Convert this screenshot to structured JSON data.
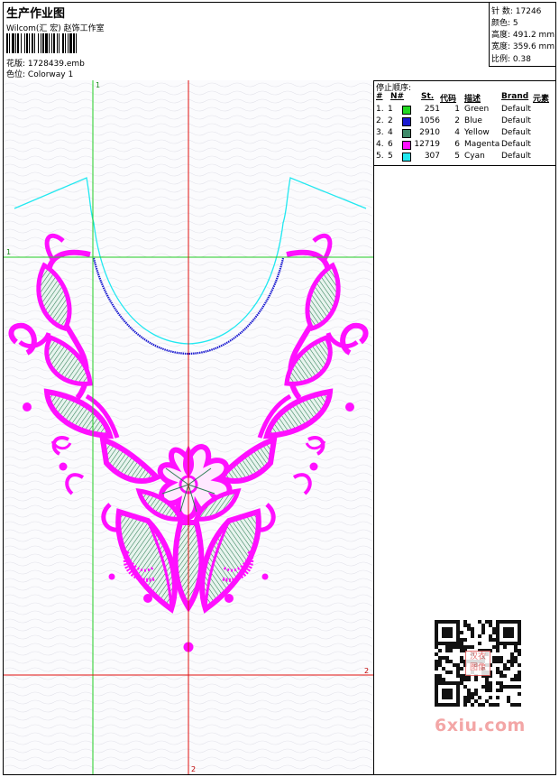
{
  "header": {
    "title": "生产作业图",
    "company": "Wilcom(汇 宏) 赵饰工作室",
    "design_label": "花版:",
    "design_value": "1728439.emb",
    "colorway_label": "色位:",
    "colorway_value": "Colorway 1"
  },
  "stats": {
    "stitches_label": "针 数:",
    "stitches_value": "17246",
    "colors_label": "颜色:",
    "colors_value": "5",
    "height_label": "高度:",
    "height_value": "491.2 mm",
    "width_label": "宽度:",
    "width_value": "359.6 mm",
    "scale_label": "比例:",
    "scale_value": "0.38"
  },
  "stop_sequence": {
    "title": "停止顺序:",
    "headers": [
      "#",
      "N#",
      "St.",
      "代码",
      "描述",
      "Brand",
      "元素"
    ],
    "rows": [
      {
        "index": "1.",
        "n": "1",
        "stitches": "251",
        "code": "1",
        "desc": "Green",
        "brand": "Default",
        "color": "#22d822"
      },
      {
        "index": "2.",
        "n": "2",
        "stitches": "1056",
        "code": "2",
        "desc": "Blue",
        "brand": "Default",
        "color": "#1a1ad0"
      },
      {
        "index": "3.",
        "n": "4",
        "stitches": "2910",
        "code": "4",
        "desc": "Yellow",
        "brand": "Default",
        "color": "#3f8a69"
      },
      {
        "index": "4.",
        "n": "6",
        "stitches": "12719",
        "code": "6",
        "desc": "Magenta",
        "brand": "Default",
        "color": "#ff10ff"
      },
      {
        "index": "5.",
        "n": "5",
        "stitches": "307",
        "code": "5",
        "desc": "Cyan",
        "brand": "Default",
        "color": "#22e8f0"
      }
    ]
  },
  "guides": {
    "green_v": "1",
    "green_h": "1",
    "red_h": "2",
    "red_v": "2"
  },
  "colors": {
    "green_guide": "#22cc22",
    "red_guide": "#e01010",
    "magenta": "#ff10ff",
    "leaf_green": "#2e7d55",
    "blue_stitch": "#1a1ad0",
    "cyan_outline": "#22e8f0"
  },
  "watermark": {
    "text": "6xiu.com",
    "seal_text": "汉衣图像"
  }
}
